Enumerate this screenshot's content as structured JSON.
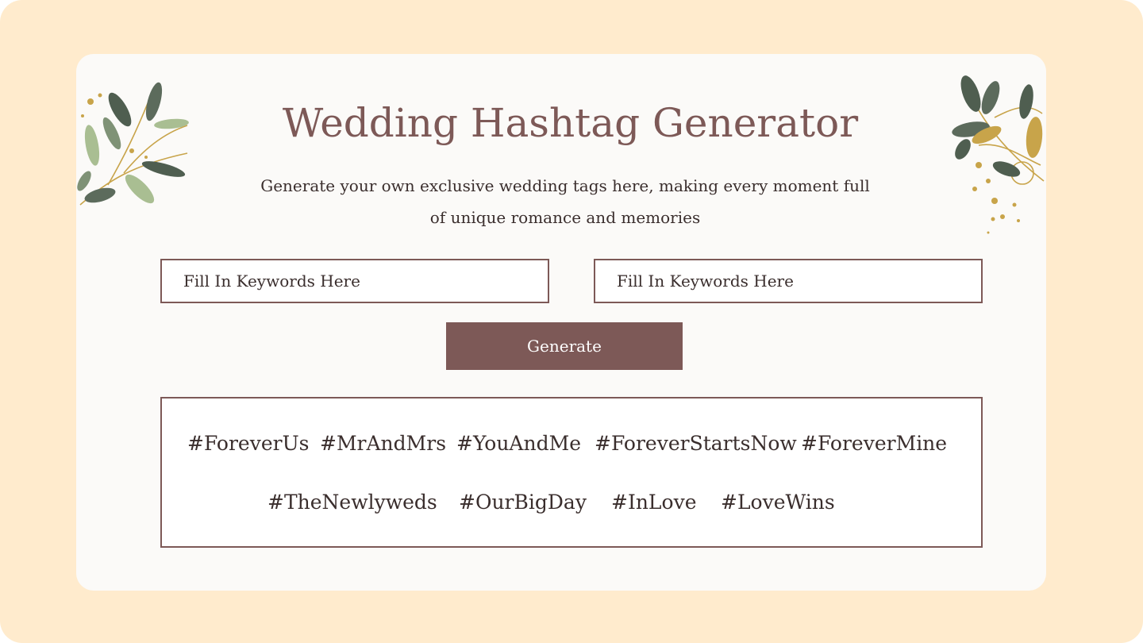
{
  "app": {
    "title": "Wedding Hashtag Generator",
    "subtitle": "Generate your own exclusive wedding tags here, making every moment full of unique romance and memories"
  },
  "form": {
    "keyword_input_1": {
      "placeholder": "Fill In Keywords Here",
      "value": ""
    },
    "keyword_input_2": {
      "placeholder": "Fill In Keywords Here",
      "value": ""
    },
    "generate_label": "Generate"
  },
  "results": {
    "hashtags": [
      "#ForeverUs",
      "#MrAndMrs",
      "#YouAndMe",
      "#ForeverStartsNow",
      "#ForeverMine",
      "#TheNewlyweds",
      "#OurBigDay",
      "#InLove",
      "#LoveWins"
    ]
  },
  "colors": {
    "page_background": "#FFEBCD",
    "card_background": "#FBFAF8",
    "accent": "#7D5957",
    "text": "#3A2E2D",
    "leaf_dark": "#4F5E50",
    "leaf_light": "#A9BE92",
    "gold": "#C8A44A"
  },
  "decorations": {
    "left": "leaf-branch-icon",
    "right": "leaf-branch-icon"
  }
}
